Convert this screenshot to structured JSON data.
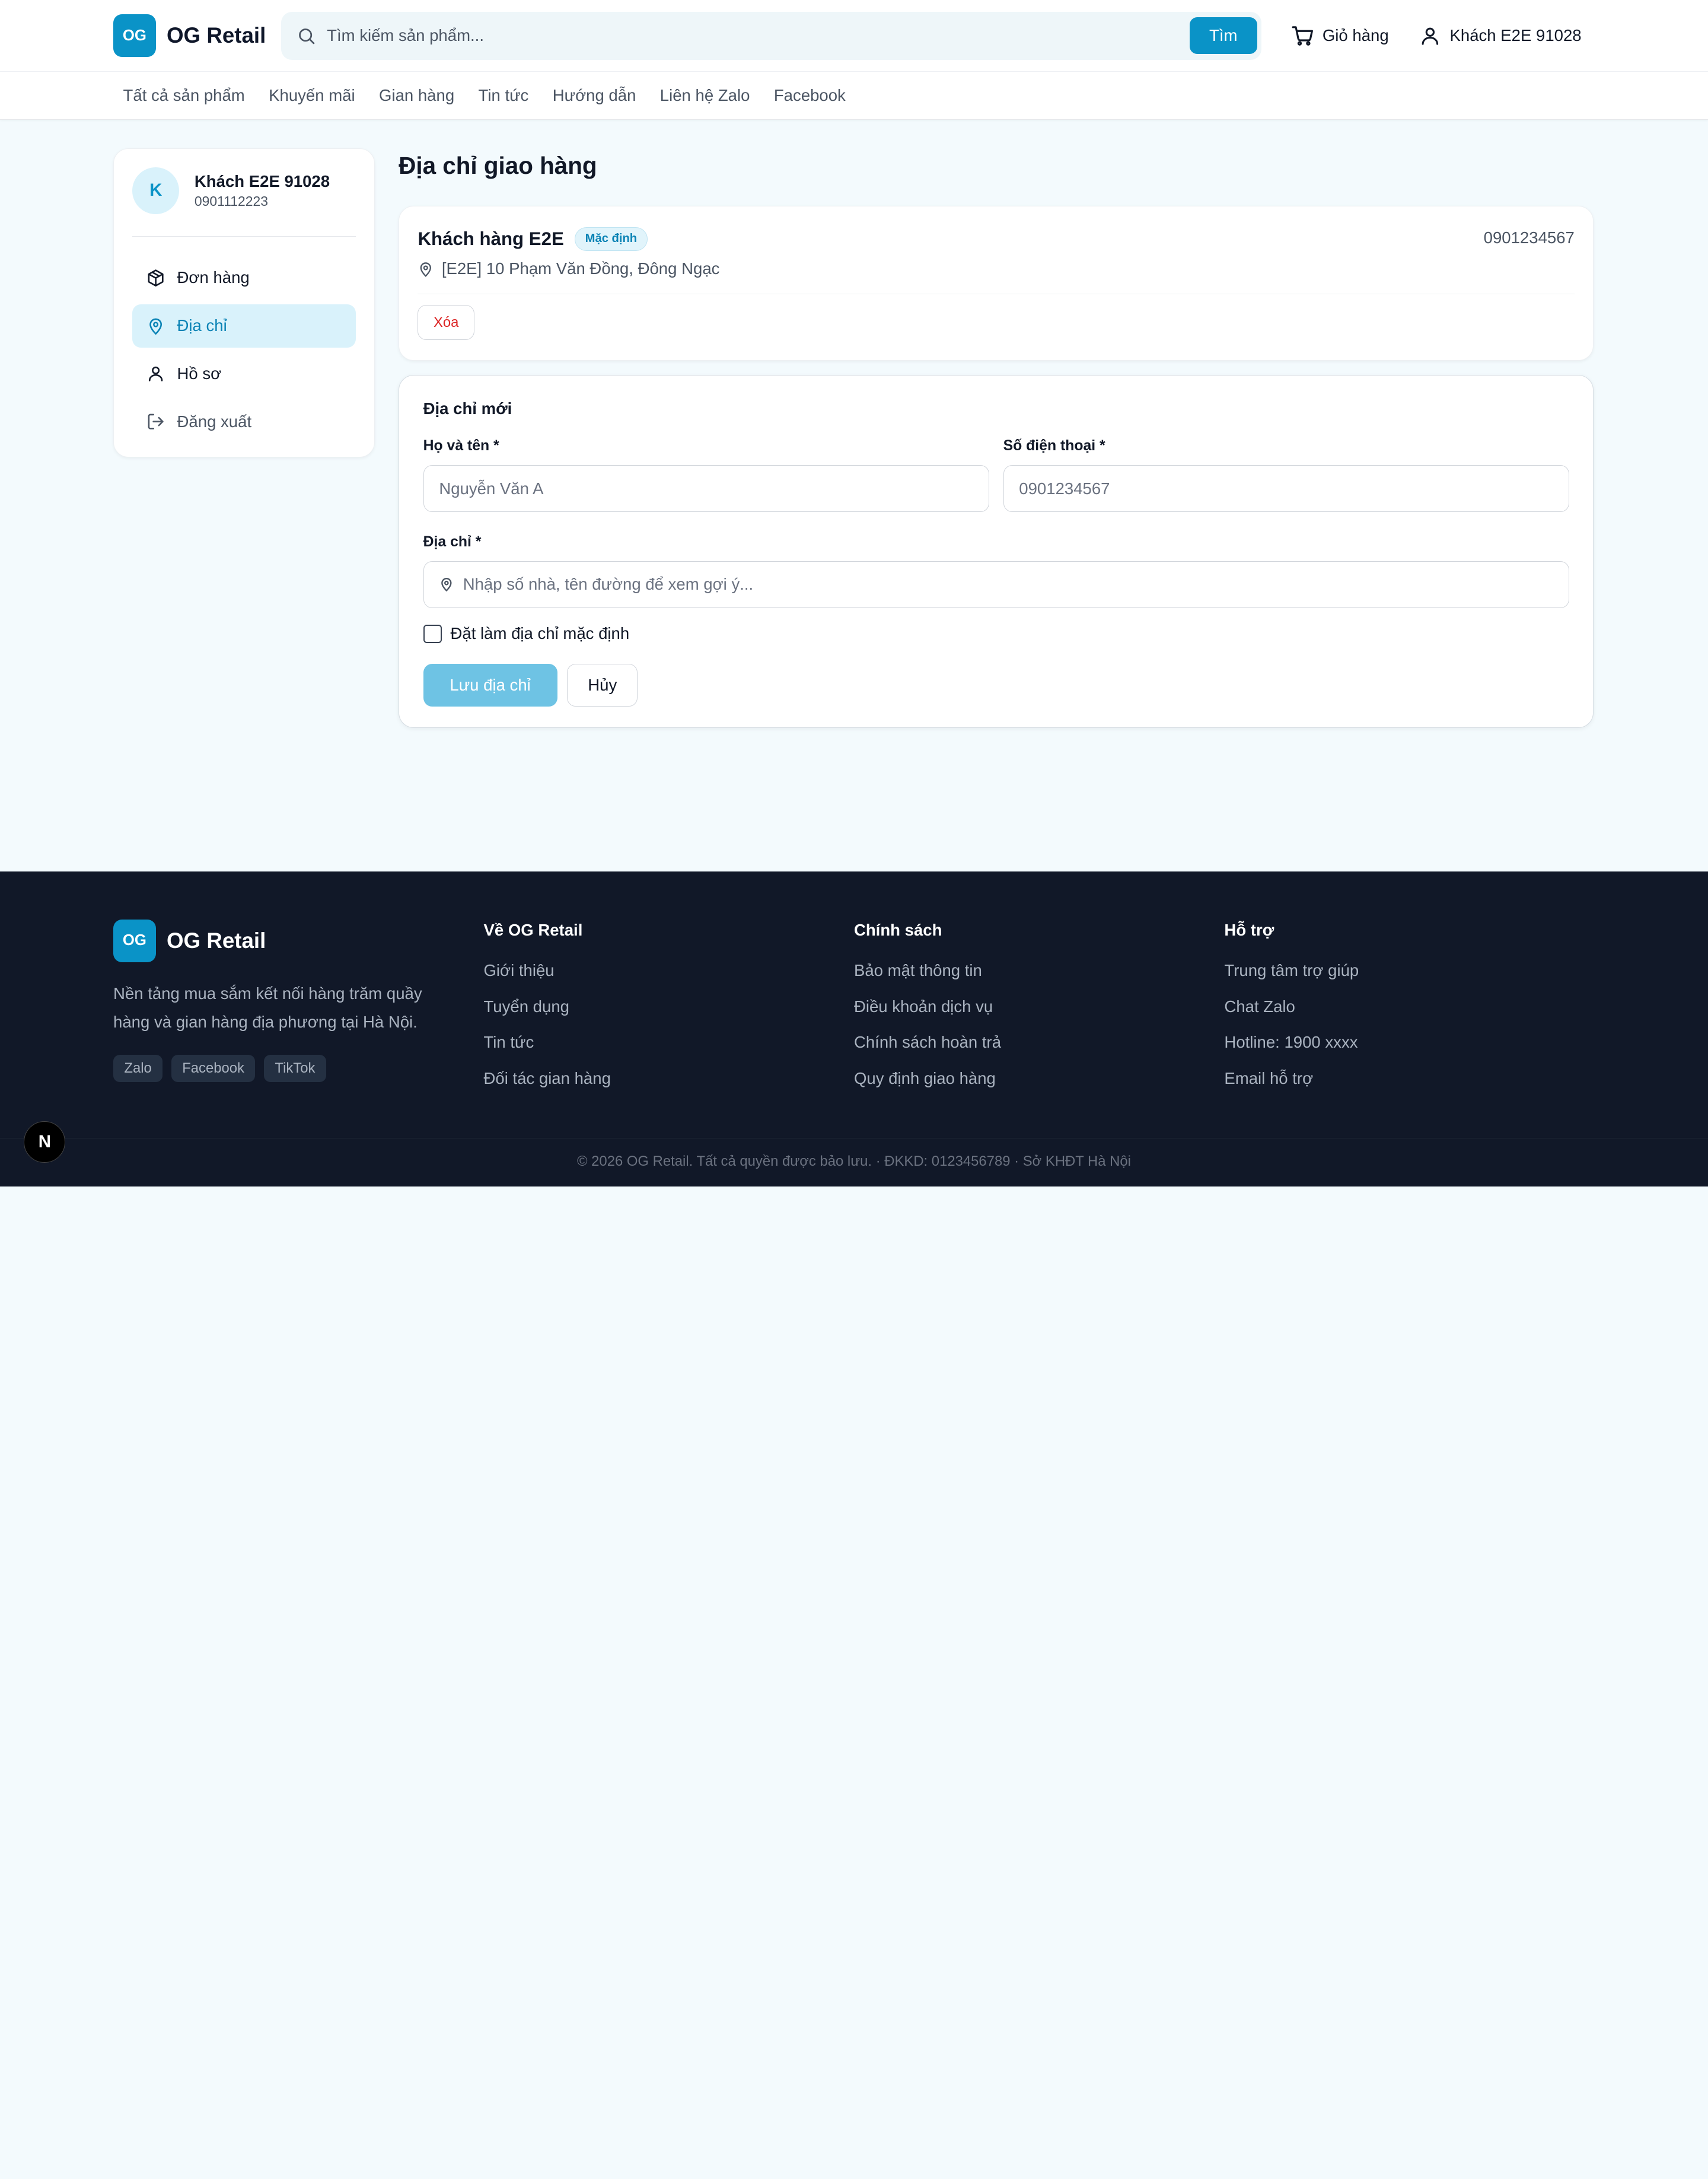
{
  "brand": {
    "logo_mark": "OG",
    "name": "OG Retail"
  },
  "header": {
    "search_placeholder": "Tìm kiếm sản phẩm...",
    "search_button": "Tìm",
    "cart_label": "Giỏ hàng",
    "user_label": "Khách E2E 91028"
  },
  "nav": {
    "items": [
      "Tất cả sản phẩm",
      "Khuyến mãi",
      "Gian hàng",
      "Tin tức",
      "Hướng dẫn",
      "Liên hệ Zalo",
      "Facebook"
    ]
  },
  "sidebar": {
    "avatar_initial": "K",
    "name": "Khách E2E 91028",
    "phone": "0901112223",
    "menu": [
      {
        "label": "Đơn hàng",
        "icon": "package-icon"
      },
      {
        "label": "Địa chỉ",
        "icon": "map-pin-icon",
        "active": true
      },
      {
        "label": "Hồ sơ",
        "icon": "user-icon"
      },
      {
        "label": "Đăng xuất",
        "icon": "logout-icon"
      }
    ]
  },
  "main": {
    "title": "Địa chỉ giao hàng",
    "saved_address": {
      "name": "Khách hàng E2E",
      "badge": "Mặc định",
      "phone": "0901234567",
      "address": "[E2E] 10 Phạm Văn Đồng, Đông Ngạc",
      "delete_label": "Xóa"
    },
    "form": {
      "title": "Địa chỉ mới",
      "name_label": "Họ và tên *",
      "name_placeholder": "Nguyễn Văn A",
      "phone_label": "Số điện thoại *",
      "phone_placeholder": "0901234567",
      "address_label": "Địa chỉ *",
      "address_placeholder": "Nhập số nhà, tên đường để xem gợi ý...",
      "default_checkbox_label": "Đặt làm địa chỉ mặc định",
      "default_checked": false,
      "save_label": "Lưu địa chỉ",
      "cancel_label": "Hủy"
    }
  },
  "footer": {
    "description": "Nền tảng mua sắm kết nối hàng trăm quầy hàng và gian hàng địa phương tại Hà Nội.",
    "socials": [
      "Zalo",
      "Facebook",
      "TikTok"
    ],
    "columns": [
      {
        "heading": "Về OG Retail",
        "links": [
          "Giới thiệu",
          "Tuyển dụng",
          "Tin tức",
          "Đối tác gian hàng"
        ]
      },
      {
        "heading": "Chính sách",
        "links": [
          "Bảo mật thông tin",
          "Điều khoản dịch vụ",
          "Chính sách hoàn trả",
          "Quy định giao hàng"
        ]
      },
      {
        "heading": "Hỗ trợ",
        "links": [
          "Trung tâm trợ giúp",
          "Chat Zalo",
          "Hotline: 1900 xxxx",
          "Email hỗ trợ"
        ]
      }
    ],
    "copyright": "© 2026 OG Retail. Tất cả quyền được bảo lưu. · ĐKKD: 0123456789 · Sở KHĐT Hà Nội"
  },
  "dev_badge": "N",
  "colors": {
    "accent": "#0a93c7",
    "accent_light": "#d9f2fb",
    "danger": "#dc2626",
    "footer_bg": "#111828",
    "page_bg": "#f3fafd"
  }
}
